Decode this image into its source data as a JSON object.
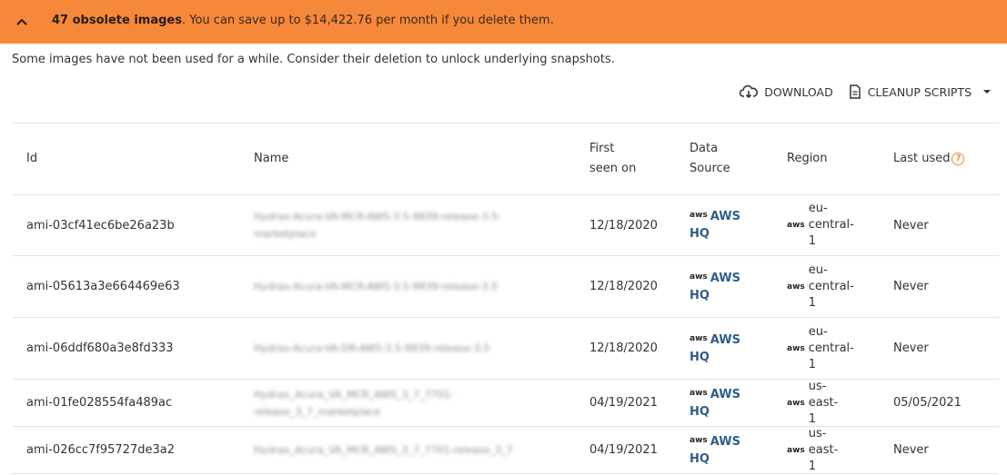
{
  "banner": {
    "count_text": "47 obsolete images",
    "message": ". You can save up to $14,422.76 per month if you delete them.",
    "background": "#f5883a",
    "toggle_icon": "chevron-up-icon"
  },
  "description": "Some images have not been used for a while. Consider their deletion to unlock underlying snapshots.",
  "actions": {
    "download_label": "DOWNLOAD",
    "cleanup_label": "CLEANUP SCRIPTS"
  },
  "table": {
    "headers": {
      "id": "Id",
      "name": "Name",
      "first_seen": "First seen on",
      "data_source": "Data Source",
      "region": "Region",
      "last_used": "Last used"
    },
    "rows": [
      {
        "id": "ami-03cf41ec6be26a23b",
        "name": "Hydrax-Acura-VA-MCR-AWS-3.5-9839-release-3.5-marketplace",
        "first_seen": "12/18/2020",
        "aws": "aws",
        "data_source": "AWS HQ",
        "region": "eu-central-1",
        "last_used": "Never"
      },
      {
        "id": "ami-05613a3e664469e63",
        "name": "Hydrax-Acura-VA-MCR-AWS-3.5-9839-release-3.5",
        "first_seen": "12/18/2020",
        "aws": "aws",
        "data_source": "AWS HQ",
        "region": "eu-central-1",
        "last_used": "Never"
      },
      {
        "id": "ami-06ddf680a3e8fd333",
        "name": "Hydrax-Acura-VA-DR-AWS-3.5-9839-release-3.5",
        "first_seen": "12/18/2020",
        "aws": "aws",
        "data_source": "AWS HQ",
        "region": "eu-central-1",
        "last_used": "Never"
      },
      {
        "id": "ami-01fe028554fa489ac",
        "name": "Hydrax_Acura_VA_MCR_AWS_3_7_7701-release_3_7_marketplace",
        "first_seen": "04/19/2021",
        "aws": "aws",
        "data_source": "AWS HQ",
        "region": "us-east-1",
        "last_used": "05/05/2021"
      },
      {
        "id": "ami-026cc7f95727de3a2",
        "name": "Hydrax_Acura_VA_MCR_AWS_3_7_7701-release_3_7",
        "first_seen": "04/19/2021",
        "aws": "aws",
        "data_source": "AWS HQ",
        "region": "us-east-1",
        "last_used": "Never"
      }
    ]
  }
}
